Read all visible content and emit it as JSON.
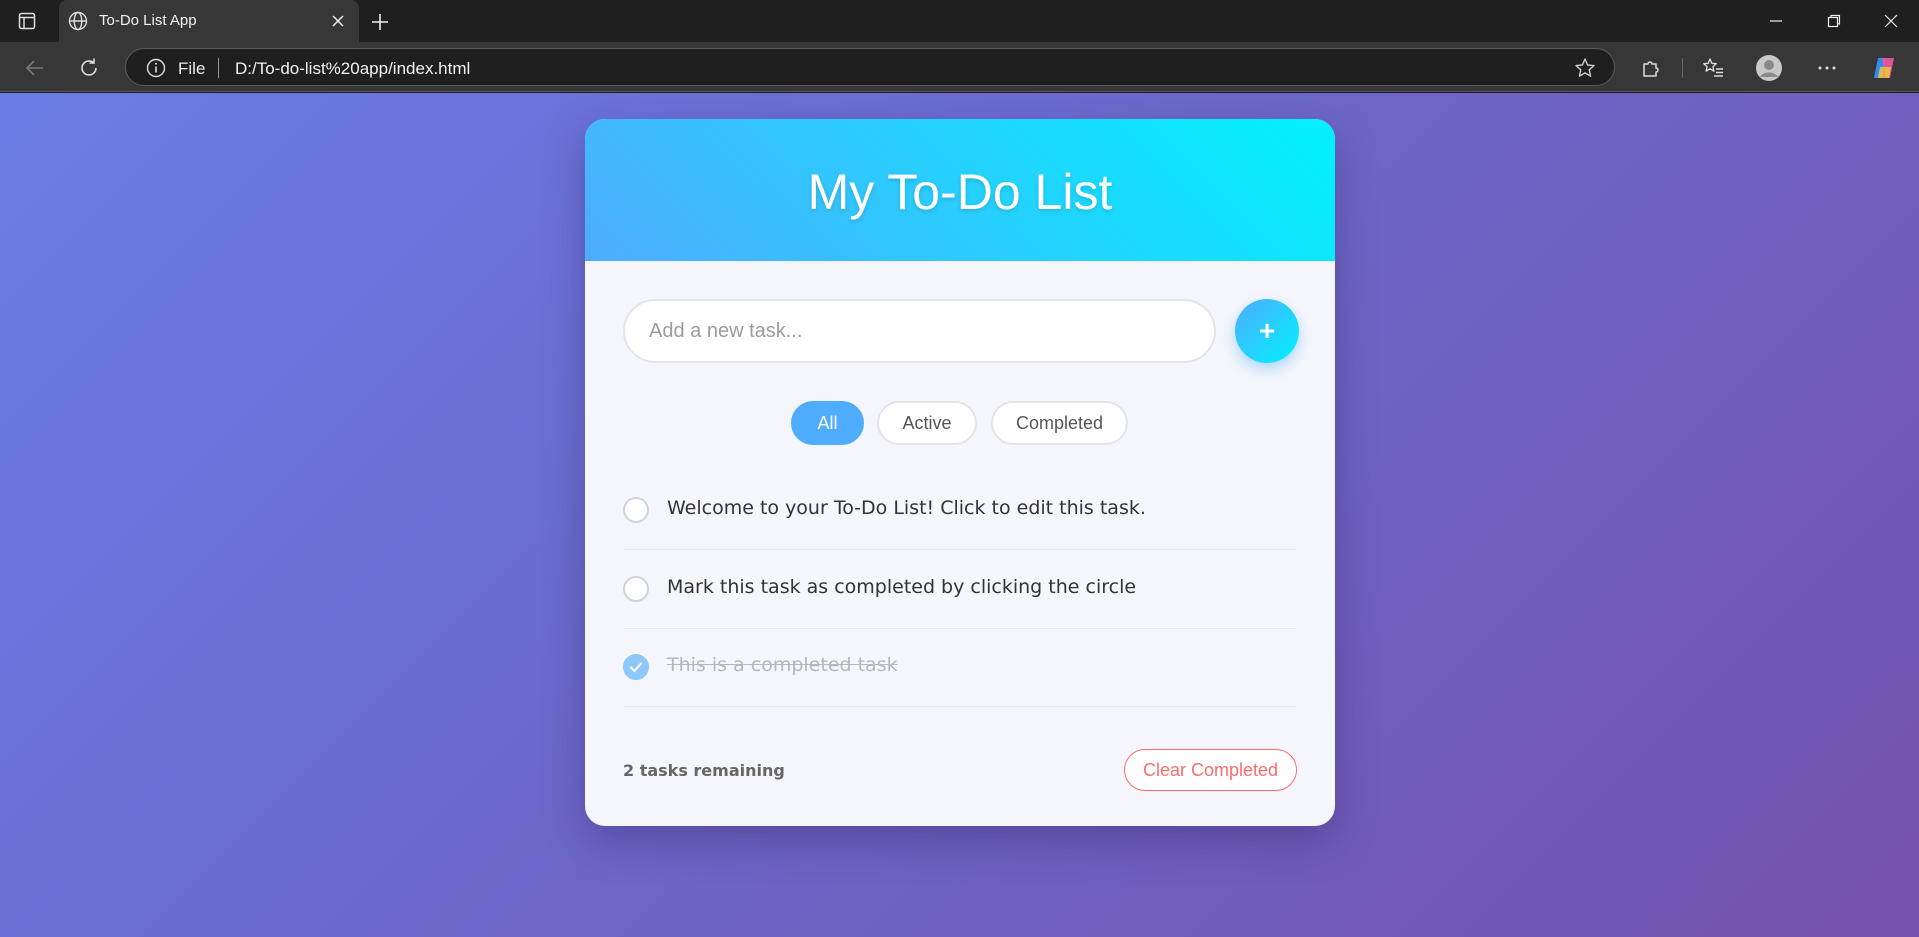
{
  "browser": {
    "tab_title": "To-Do List App",
    "address_scheme": "File",
    "address_url": "D:/To-do-list%20app/index.html"
  },
  "app": {
    "title": "My To-Do List",
    "input": {
      "placeholder": "Add a new task...",
      "value": ""
    },
    "add_label": "+",
    "filters": [
      {
        "label": "All",
        "active": true
      },
      {
        "label": "Active",
        "active": false
      },
      {
        "label": "Completed",
        "active": false
      }
    ],
    "tasks": [
      {
        "text": "Welcome to your To-Do List! Click to edit this task.",
        "completed": false
      },
      {
        "text": "Mark this task as completed by clicking the circle",
        "completed": false
      },
      {
        "text": "This is a completed task",
        "completed": true
      }
    ],
    "remaining_text": "2 tasks remaining",
    "clear_label": "Clear Completed"
  },
  "colors": {
    "accent": "#4facfe",
    "accent_end": "#00f2fe",
    "danger": "#ff6b6b",
    "completed_check": "#8cc9fa"
  }
}
